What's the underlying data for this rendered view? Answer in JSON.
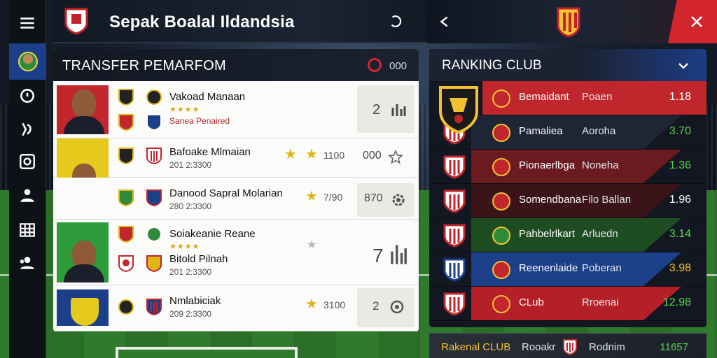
{
  "header": {
    "title": "Sepak Boalal Ildandsia"
  },
  "transfer": {
    "title": "TRANSFER PEMARFOM",
    "count": "000",
    "rows": [
      {
        "name": "Vakoad Manaan",
        "stars": "★★★★",
        "meta": "Sanea Penaired",
        "rating": "",
        "action_text": "2",
        "action_icon": "stats-icon"
      },
      {
        "name": "Bafoake Mlmaian",
        "stars": "",
        "meta": "201 2:3300",
        "rating": "1100",
        "action_text": "000",
        "action_icon": "star-outline-icon"
      },
      {
        "name": "Danood Sapral Molarian",
        "stars": "",
        "meta": "280 2:3300",
        "rating": "7/90",
        "action_text": "870",
        "action_icon": "gear-icon"
      },
      {
        "name": "Soiakeanie Reane",
        "stars": "★★★★",
        "meta": "Bitold Pilnah",
        "meta2": "201 2:3300",
        "rating": "",
        "action_text": "7",
        "action_icon": "stats-icon"
      },
      {
        "name": "Nmlabiciak",
        "stars": "",
        "meta": "209 2:3300",
        "rating": "3100",
        "action_text": "2",
        "action_icon": "target-icon"
      }
    ]
  },
  "ranking": {
    "title": "RANKING CLUB",
    "rows": [
      {
        "club": "Bemaidant",
        "rank": "Poaen",
        "score": "1.18",
        "score_color": "#ffffff",
        "band": "#c0262c"
      },
      {
        "club": "Pamaliea",
        "rank": "Aoroha",
        "score": "3.70",
        "score_color": "#58d44f",
        "band": "#1e2636"
      },
      {
        "club": "Pionaerlbga",
        "rank": "Noneha",
        "score": "1.36",
        "score_color": "#58d44f",
        "band": "#6b1a20"
      },
      {
        "club": "Somendbana",
        "rank": "Filo Ballan",
        "score": "1.96",
        "score_color": "#ffffff",
        "band": "#3a1418"
      },
      {
        "club": "Pahbelrlkart",
        "rank": "Arluedn",
        "score": "3.14",
        "score_color": "#58d44f",
        "band": "#1f4d22"
      },
      {
        "club": "Reenenlaide",
        "rank": "Poberan",
        "score": "3.98",
        "score_color": "#f0c430",
        "band": "#1c3f8a"
      },
      {
        "club": "CLub",
        "rank": "Rroenai",
        "score": "12.98",
        "score_color": "#58d44f",
        "band": "#b51f28"
      }
    ]
  },
  "own_club": {
    "name": "Rakenal CLUB",
    "rank": "Rooakr",
    "pos": "Rodnim",
    "score": "11657"
  }
}
